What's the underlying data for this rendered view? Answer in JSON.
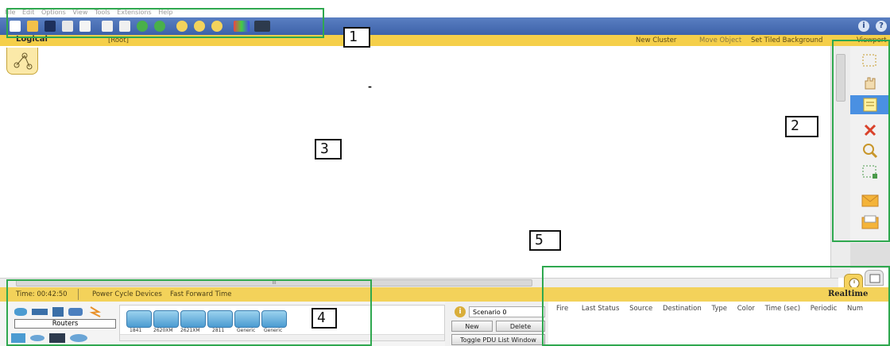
{
  "menu": {
    "items": [
      "File",
      "Edit",
      "Options",
      "View",
      "Tools",
      "Extensions",
      "Help"
    ]
  },
  "toolbar": {
    "icons": [
      "new-file-icon",
      "open-folder-icon",
      "save-icon",
      "print-icon",
      "activity-wizard-icon",
      "copy-icon",
      "paste-icon",
      "undo-icon",
      "redo-icon",
      "zoom-in-icon",
      "zoom-reset-icon",
      "zoom-out-icon",
      "palette-icon",
      "custom-device-icon"
    ],
    "help_info": "i",
    "help_question": "?"
  },
  "logical_bar": {
    "tab": "Logical",
    "root": "[Root]",
    "new_cluster": "New Cluster",
    "move_object": "Move Object",
    "set_tiled_background": "Set Tiled Background",
    "viewport": "Viewport"
  },
  "workspace": {
    "marker": "-"
  },
  "right_tools": [
    "select-icon",
    "hand-move-icon",
    "note-icon",
    "delete-icon",
    "inspect-icon",
    "resize-icon",
    "simple-pdu-icon",
    "complex-pdu-icon"
  ],
  "scrollbar": {
    "grip": "III"
  },
  "status": {
    "time": "Time: 00:42:50",
    "power_cycle": "Power Cycle Devices",
    "fast_forward": "Fast Forward Time",
    "mode": "Realtime"
  },
  "device_panel": {
    "category": "Routers",
    "devices": [
      "1841",
      "2620XM",
      "2621XM",
      "2811",
      "Generic",
      "Generic"
    ]
  },
  "scenario": {
    "info_icon": "i",
    "name": "Scenario 0",
    "new": "New",
    "delete": "Delete",
    "toggle": "Toggle PDU List Window"
  },
  "pdu_table": {
    "columns": [
      "Fire",
      "Last Status",
      "Source",
      "Destination",
      "Type",
      "Color",
      "Time (sec)",
      "Periodic",
      "Num"
    ]
  },
  "annotations": {
    "labels": [
      "1",
      "2",
      "3",
      "4",
      "5"
    ],
    "color": "#2fa84f"
  }
}
